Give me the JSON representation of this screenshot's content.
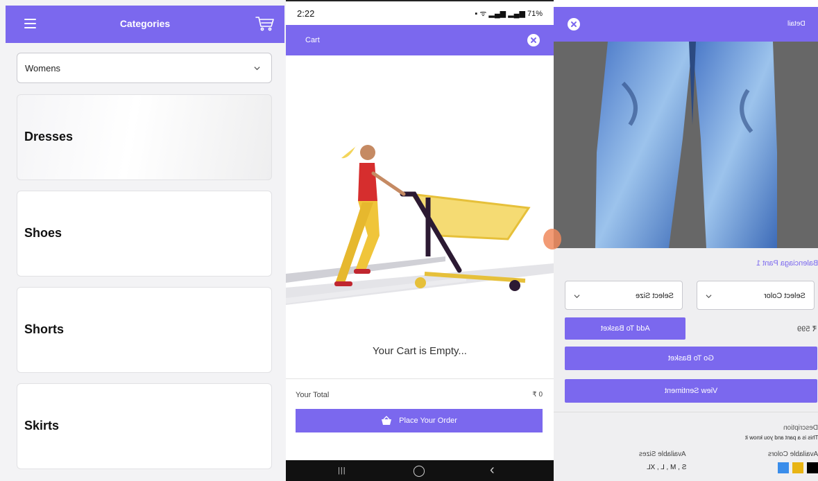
{
  "categories_screen": {
    "title": "Categories",
    "menu_icon": "hamburger-menu-icon",
    "cart_icon": "shopping-cart-icon",
    "dropdown": {
      "selected": "Womens",
      "icon": "chevron-down-icon"
    },
    "items": [
      {
        "label": "Dresses"
      },
      {
        "label": "Shoes"
      },
      {
        "label": "Shorts"
      },
      {
        "label": "Skirts"
      }
    ]
  },
  "cart_screen": {
    "status_bar": {
      "time": "2:22",
      "battery": "71%"
    },
    "title": "Cart",
    "close_icon": "close-circle-icon",
    "empty_message": "Your Cart is Empty...",
    "total_label": "Your Total",
    "total_value": "₹ 0",
    "place_order_label": "Place Your Order",
    "place_order_icon": "basket-icon",
    "nav": {
      "recent": "|||",
      "home": "◯",
      "back": "‹"
    }
  },
  "detail_screen": {
    "title": "Detail",
    "close_icon": "close-circle-icon",
    "product_name": "Balenciaga Pant 1",
    "select_color": "Select Color",
    "select_size": "Select Size",
    "price": "₹ 599",
    "add_to_basket": "Add To Basket",
    "go_to_basket": "Go To Basket",
    "view_sentiment": "View Sentiment",
    "description_heading": "Description",
    "description_text": "This is a pant and you know it",
    "available_colors_heading": "Available Colors",
    "available_sizes_heading": "Available Sizes",
    "available_sizes": "S , M , L , XL",
    "colors": [
      "#000000",
      "#e8b414",
      "#3a8dea"
    ]
  },
  "accent_color": "#7b68ee"
}
